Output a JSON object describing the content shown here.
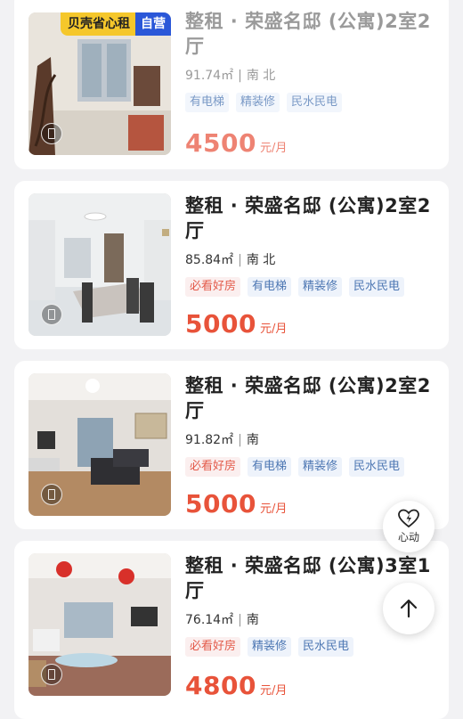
{
  "listings": [
    {
      "title": "整租 · 荣盛名邸 (公寓)2室2厅",
      "area": "91.74㎡",
      "orientation": "南 北",
      "tags": [
        {
          "label": "有电梯",
          "style": "blue"
        },
        {
          "label": "精装修",
          "style": "blue"
        },
        {
          "label": "民水民电",
          "style": "blue"
        }
      ],
      "price": "4500",
      "price_unit": "元/月",
      "badge": {
        "main": "贝壳省心租",
        "self": "自营"
      },
      "faded": true
    },
    {
      "title": "整租 · 荣盛名邸 (公寓)2室2厅",
      "area": "85.84㎡",
      "orientation": "南 北",
      "tags": [
        {
          "label": "必看好房",
          "style": "red"
        },
        {
          "label": "有电梯",
          "style": "blue"
        },
        {
          "label": "精装修",
          "style": "blue"
        },
        {
          "label": "民水民电",
          "style": "blue"
        }
      ],
      "price": "5000",
      "price_unit": "元/月",
      "faded": false
    },
    {
      "title": "整租 · 荣盛名邸 (公寓)2室2厅",
      "area": "91.82㎡",
      "orientation": "南",
      "tags": [
        {
          "label": "必看好房",
          "style": "red"
        },
        {
          "label": "有电梯",
          "style": "blue"
        },
        {
          "label": "精装修",
          "style": "blue"
        },
        {
          "label": "民水民电",
          "style": "blue"
        }
      ],
      "price": "5000",
      "price_unit": "元/月",
      "faded": false
    },
    {
      "title": "整租 · 荣盛名邸 (公寓)3室1厅",
      "area": "76.14㎡",
      "orientation": "南",
      "tags": [
        {
          "label": "必看好房",
          "style": "red"
        },
        {
          "label": "精装修",
          "style": "blue"
        },
        {
          "label": "民水民电",
          "style": "blue"
        }
      ],
      "price": "4800",
      "price_unit": "元/月",
      "faded": false
    }
  ],
  "separator": "|",
  "fab_favorite": {
    "label": "心动",
    "icon": "heart-lightning-icon"
  },
  "fab_top": {
    "icon": "arrow-up-icon"
  },
  "colors": {
    "price": "#e8533a",
    "tag_blue_text": "#4d77b3",
    "tag_red_text": "#e35a4a",
    "badge_yellow": "#f5c72b",
    "badge_blue": "#2a57d8"
  }
}
